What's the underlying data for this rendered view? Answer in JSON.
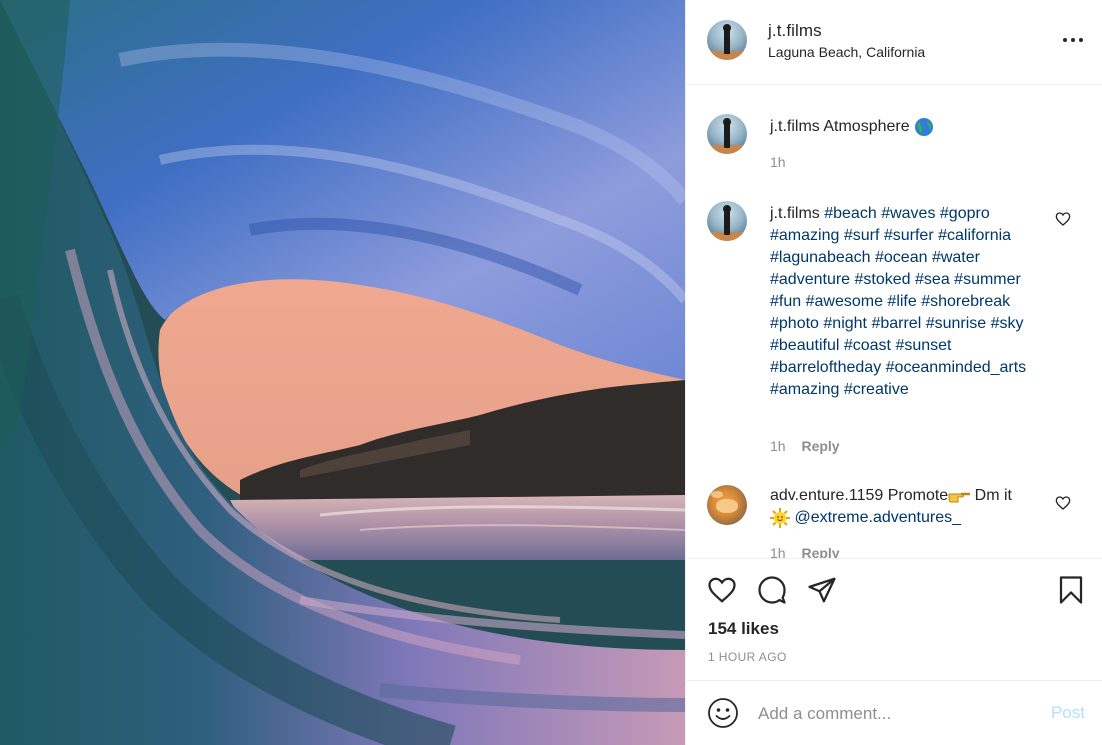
{
  "post": {
    "username": "j.t.films",
    "location": "Laguna Beach, California"
  },
  "comments": [
    {
      "username": "j.t.films",
      "text": "Atmosphere",
      "emoji_icon": "globe-icon",
      "time": "1h"
    },
    {
      "username": "j.t.films",
      "hashtags": [
        "#beach",
        "#waves",
        "#gopro",
        "#amazing",
        "#surf",
        "#surfer",
        "#california",
        "#lagunabeach",
        "#ocean",
        "#water",
        "#adventure",
        "#stoked",
        "#sea",
        "#summer",
        "#fun",
        "#awesome",
        "#life",
        "#shorebreak",
        "#photo",
        "#night",
        "#barrel",
        "#sunrise",
        "#sky",
        "#beautiful",
        "#coast",
        "#sunset",
        "#barreloftheday",
        "#oceanminded_arts",
        "#amazing",
        "#creative"
      ],
      "time": "1h",
      "reply": "Reply"
    },
    {
      "username": "adv.enture.1159",
      "text_before": "Promote",
      "emoji1_icon": "pointing-hand-icon",
      "text_middle": "Dm it",
      "emoji2_icon": "sun-face-icon",
      "mention": "@extreme.adventures_",
      "time": "1h",
      "reply": "Reply"
    }
  ],
  "actions": {
    "likes": "154 likes",
    "timeago": "1 HOUR AGO"
  },
  "add_comment": {
    "placeholder": "Add a comment...",
    "post_label": "Post"
  },
  "colors": {
    "hashtag": "#00376b",
    "muted": "#8e8e8e",
    "post_disabled": "#b2dffc"
  }
}
